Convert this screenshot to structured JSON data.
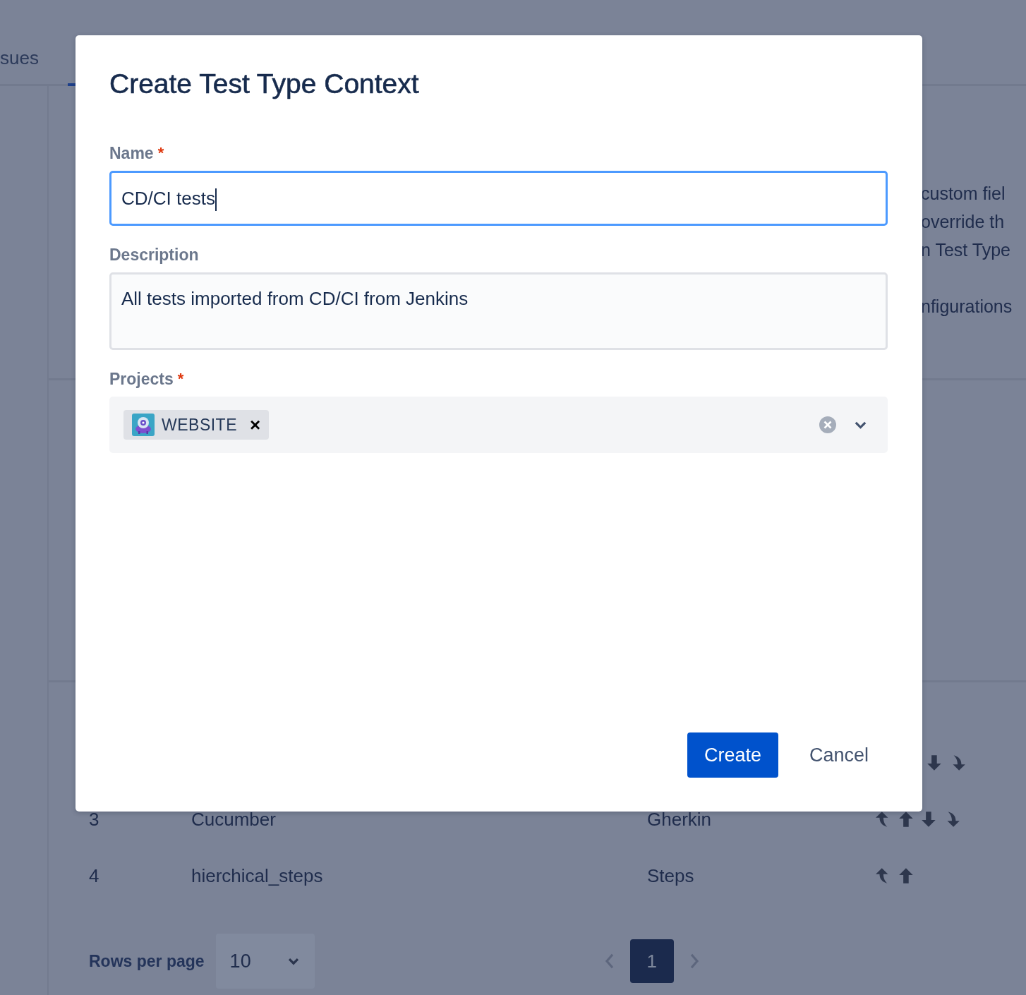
{
  "background": {
    "tabs": [
      {
        "label": "sues",
        "selected": false
      },
      {
        "selected": true
      }
    ],
    "info_paragraphs": [
      [
        "custom fiel",
        "override th",
        "n Test Type"
      ],
      [
        "nfigurations"
      ]
    ],
    "table_rows": [
      {
        "actions": [
          {
            "kind": "move-down"
          },
          {
            "kind": "move-bottom"
          }
        ]
      },
      {
        "number": "3",
        "name": "Cucumber",
        "type": "Gherkin",
        "actions": [
          {
            "kind": "move-top"
          },
          {
            "kind": "move-up"
          },
          {
            "kind": "move-down"
          },
          {
            "kind": "move-bottom"
          }
        ]
      },
      {
        "number": "4",
        "name": "hierchical_steps",
        "type": "Steps",
        "actions": [
          {
            "kind": "move-top"
          },
          {
            "kind": "move-up"
          }
        ]
      }
    ],
    "pagination": {
      "label": "Rows per page",
      "rows_per_page": "10",
      "pages": [
        {
          "label": "1",
          "selected": true
        }
      ]
    }
  },
  "modal": {
    "title": "Create Test Type Context",
    "fields": [
      {
        "kind": "text",
        "label": "Name",
        "required_mark": "*",
        "value": "CD/CI tests",
        "focused": true
      },
      {
        "kind": "textarea",
        "label": "Description",
        "value": "All tests imported from CD/CI from Jenkins",
        "focused": false
      },
      {
        "kind": "multiselect",
        "label": "Projects",
        "required_mark": "*",
        "chips": [
          {
            "label": "WEBSITE",
            "remove": "×"
          }
        ]
      }
    ],
    "buttons": [
      {
        "label": "Create",
        "kind": "primary"
      },
      {
        "label": "Cancel",
        "kind": "subtle"
      }
    ]
  }
}
